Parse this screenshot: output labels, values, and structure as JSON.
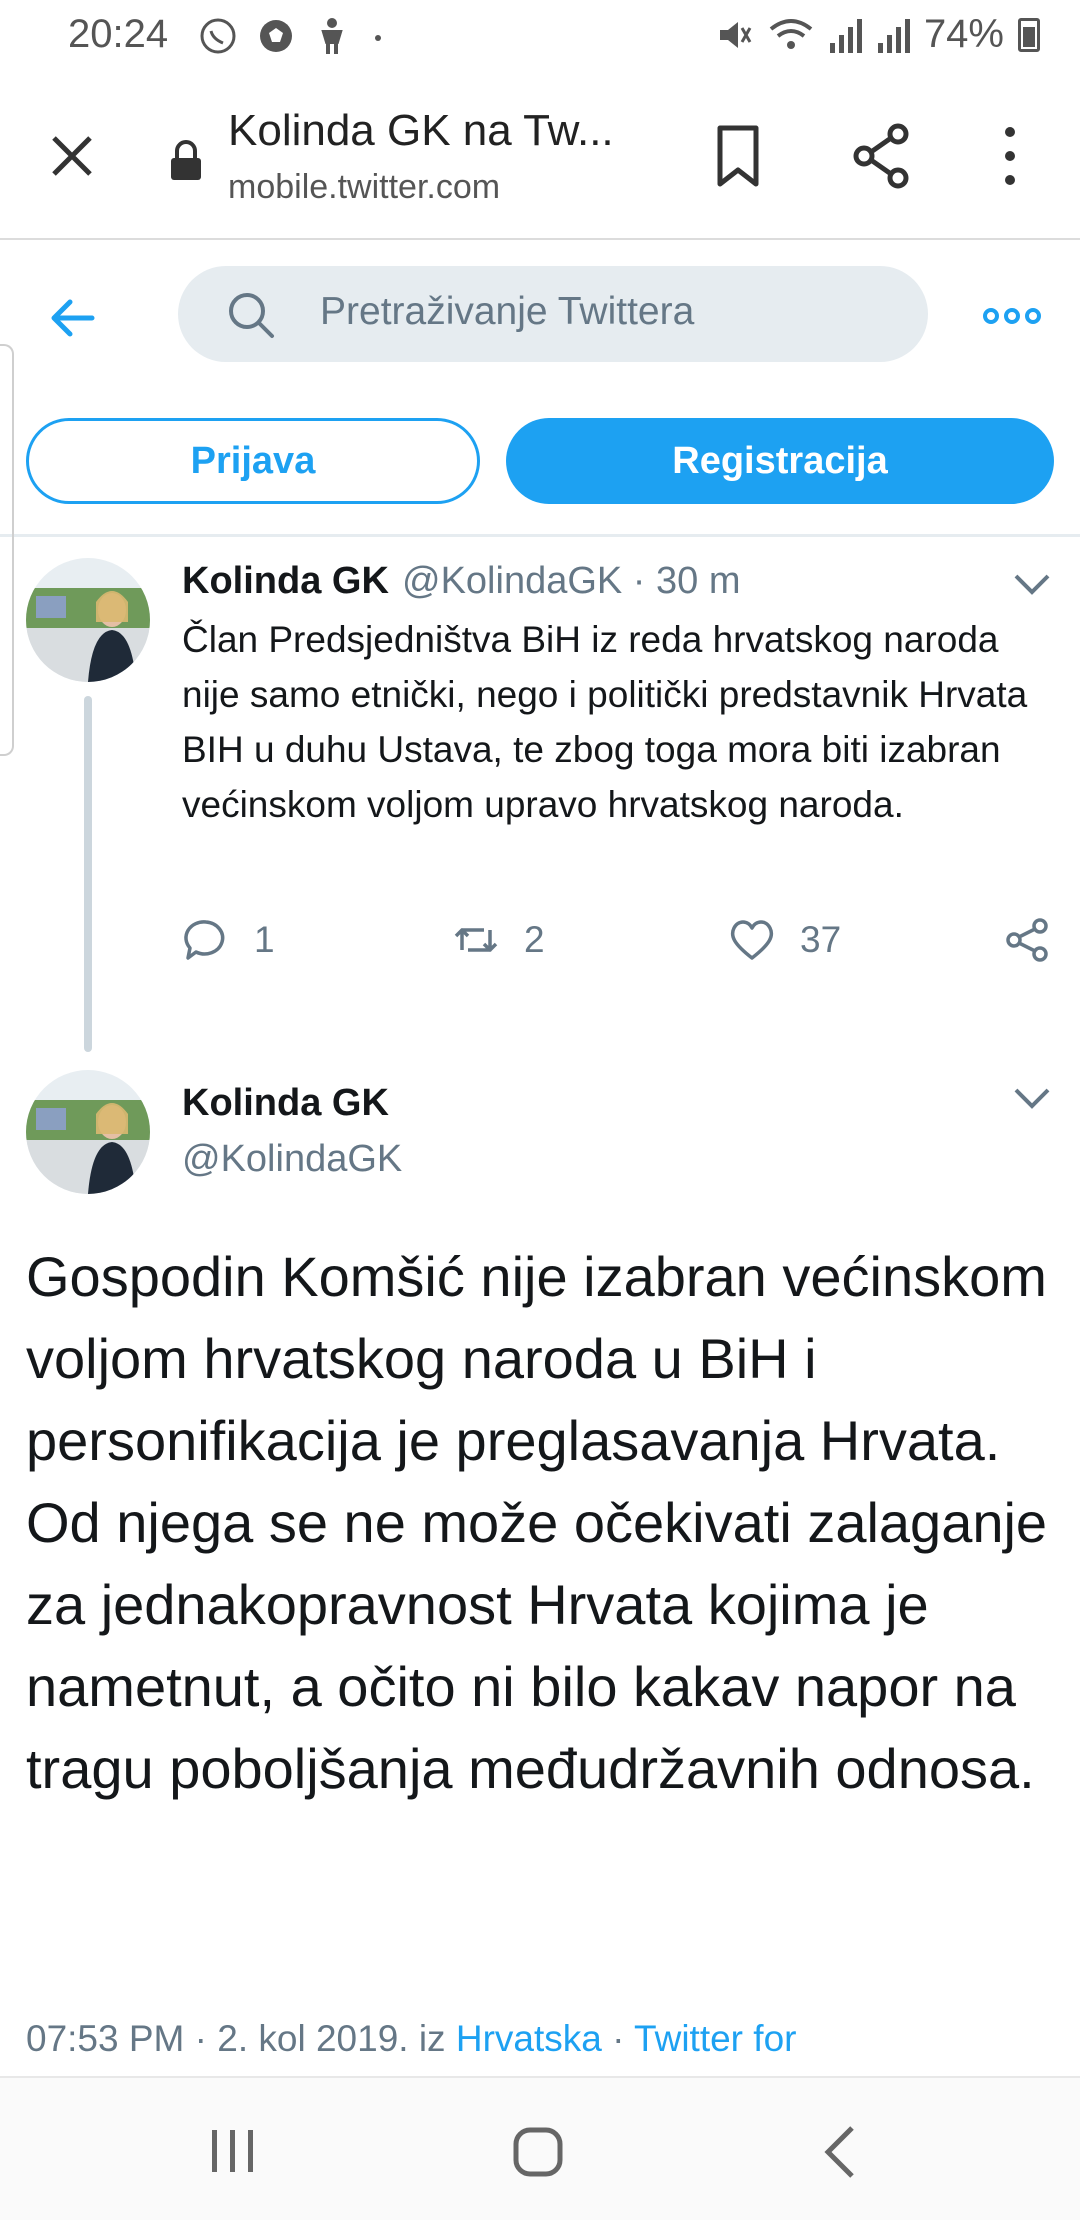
{
  "status_bar": {
    "time": "20:24",
    "battery": "74%",
    "icons_left": [
      "whatsapp-icon",
      "soccer-icon",
      "figure-icon",
      "dot-icon"
    ],
    "icons_right": [
      "mute-icon",
      "wifi-icon",
      "signal-icon",
      "signal-icon",
      "battery-icon"
    ]
  },
  "browser": {
    "title": "Kolinda GK na Tw...",
    "url": "mobile.twitter.com"
  },
  "twitter": {
    "search_placeholder": "Pretraživanje Twittera",
    "login_label": "Prijava",
    "signup_label": "Registracija",
    "accent_color": "#1da1f2"
  },
  "tweet1": {
    "name": "Kolinda GK",
    "handle_time": "@KolindaGK · 30 m",
    "text": "Član Predsjedništva BiH iz reda hrvatskog naroda nije samo etnički, nego i politički predstavnik Hrvata BIH u duhu Ustava, te zbog toga mora biti izabran većinskom voljom upravo hrvatskog naroda.",
    "replies": "1",
    "retweets": "2",
    "likes": "37"
  },
  "tweet2": {
    "name": "Kolinda GK",
    "handle": "@KolindaGK",
    "text": "Gospodin Komšić nije izabran većinskom voljom hrvatskog naroda u BiH i personifikacija je preglasavanja Hrvata. Od njega se ne može očekivati zalaganje za jednakopravnost Hrvata kojima je nametnut, a očito ni bilo kakav napor na tragu poboljšanja međudržavnih odnosa.",
    "meta_prefix": "07:53 PM · 2. kol 2019. iz ",
    "location": "Hrvatska",
    "separator": " · ",
    "source": "Twitter for"
  }
}
